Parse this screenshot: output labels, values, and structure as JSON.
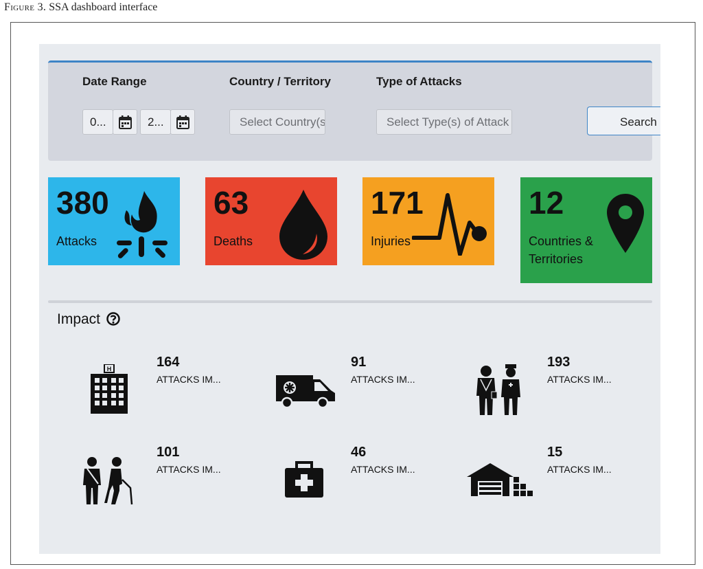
{
  "caption": {
    "figure": "Figure 3.",
    "text": "SSA dashboard interface"
  },
  "filters": {
    "date_range_label": "Date Range",
    "country_label": "Country / Territory",
    "attack_type_label": "Type of Attacks",
    "date_from_value": "0...",
    "date_to_value": "2...",
    "country_placeholder": "Select Country(s)",
    "attack_type_placeholder": "Select Type(s) of Attack",
    "search_label": "Search"
  },
  "stats": [
    {
      "value": "380",
      "label": "Attacks",
      "color": "#2db6ea",
      "icon": "fire-icon"
    },
    {
      "value": "63",
      "label": "Deaths",
      "color": "#e8452f",
      "icon": "blood-drop-icon"
    },
    {
      "value": "171",
      "label": "Injuries",
      "color": "#f5a020",
      "icon": "heartbeat-icon"
    },
    {
      "value": "12",
      "label_line1": "Countries &",
      "label_line2": "Territories",
      "color": "#2aa14b",
      "icon": "map-pin-icon"
    }
  ],
  "impact": {
    "title": "Impact",
    "items": [
      {
        "value": "164",
        "label": "ATTACKS IM...",
        "icon": "hospital-icon"
      },
      {
        "value": "91",
        "label": "ATTACKS IM...",
        "icon": "ambulance-icon"
      },
      {
        "value": "193",
        "label": "ATTACKS IM...",
        "icon": "health-workers-icon"
      },
      {
        "value": "101",
        "label": "ATTACKS IM...",
        "icon": "patients-icon"
      },
      {
        "value": "46",
        "label": "ATTACKS IM...",
        "icon": "first-aid-kit-icon"
      },
      {
        "value": "15",
        "label": "ATTACKS IM...",
        "icon": "warehouse-icon"
      }
    ]
  },
  "colors": {
    "accent": "#3d84c6",
    "dashboard_bg": "#e8ebef",
    "filter_bg": "#d3d6de"
  }
}
